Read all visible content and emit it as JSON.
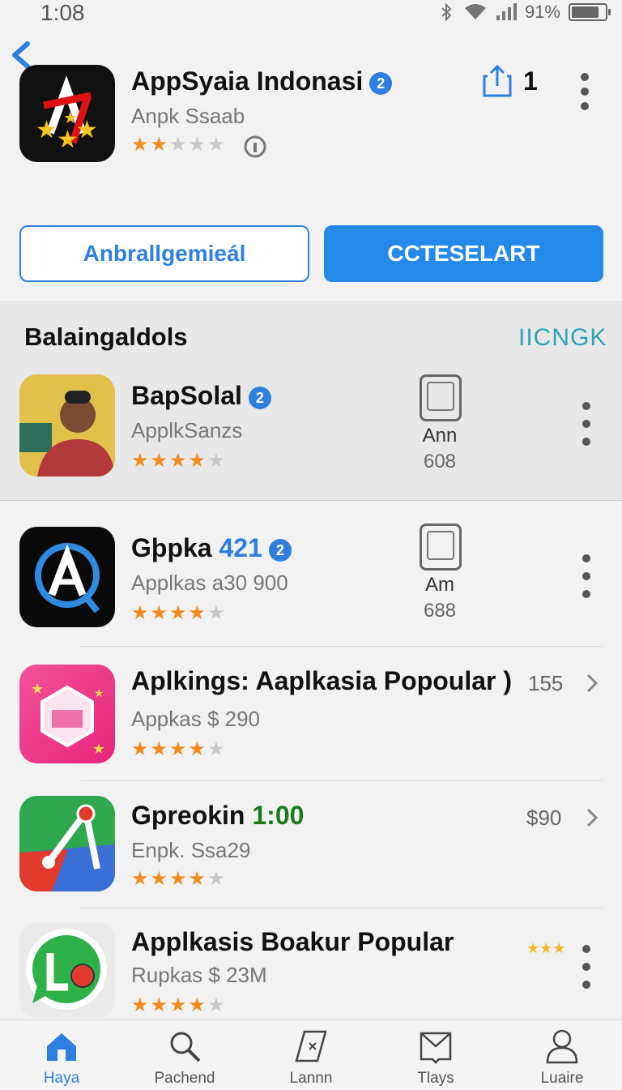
{
  "status": {
    "time": "1:08",
    "battery": "91%",
    "battery_level": 0.91
  },
  "header": {
    "app_name": "AppSyaia Indonasi",
    "badge": "2",
    "developer": "Anpk Ssaab",
    "rating_filled": 2,
    "share_count": "1",
    "install_button": "Anbrallgemieál",
    "open_button": "CCTESELART"
  },
  "section": {
    "title": "Balaingaldols",
    "link": "IICNGK"
  },
  "featured": [
    {
      "name": "BapSolal",
      "badge": "2",
      "sub": "ApplkSanzs",
      "stars": 4,
      "device_label": "Ann",
      "device_count": "608"
    },
    {
      "name": "Gþpka ",
      "name_accent": "421",
      "badge": "2",
      "sub": "Applkas a30 900",
      "stars": 4,
      "device_label": "Am",
      "device_count": "688"
    }
  ],
  "list": [
    {
      "name": "Aplkings: Aaplkasia Popoular )",
      "sub": "Appkas $ 290",
      "stars": 4,
      "price": "155"
    },
    {
      "name": "Gpreokin ",
      "name_accent": "1:00",
      "sub": "Enpk. Ssa29",
      "stars": 4,
      "price": "$90"
    },
    {
      "name": "Applkasis Boakur Popular",
      "sub": "Rupkas $ 23M",
      "stars": 4,
      "mini_stars": "★★★"
    }
  ],
  "tabs": [
    {
      "label": "Haya",
      "icon": "home-icon",
      "active": true
    },
    {
      "label": "Pachend",
      "icon": "search-icon",
      "active": false
    },
    {
      "label": "Lannn",
      "icon": "map-icon",
      "active": false
    },
    {
      "label": "Tlays",
      "icon": "inbox-icon",
      "active": false
    },
    {
      "label": "Luaire",
      "icon": "person-icon",
      "active": false
    }
  ],
  "colors": {
    "accent": "#2f7fe0",
    "star": "#f28a1e",
    "link": "#2fa3b8",
    "accent_green": "#1a7a1a"
  }
}
